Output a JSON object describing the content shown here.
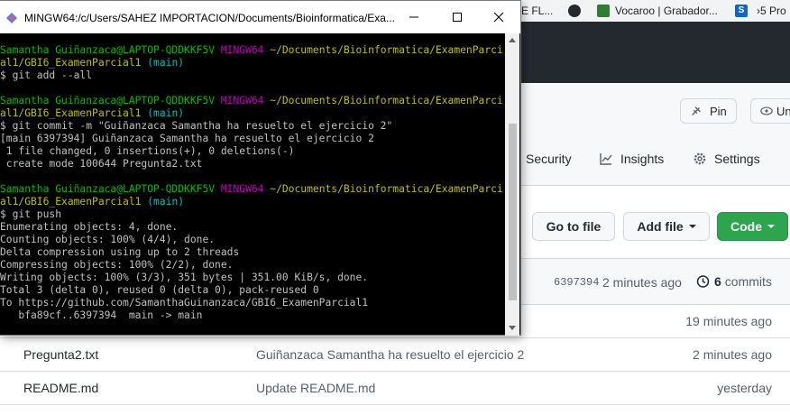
{
  "bookmarks": [
    {
      "label": "E FL...",
      "icon": "bookmark-icon"
    },
    {
      "label": "",
      "icon": "github-icon"
    },
    {
      "label": "Vocaroo | Grabador...",
      "icon": "vocaroo-icon"
    },
    {
      "label": "5 Pro",
      "icon": "s-icon"
    }
  ],
  "repo_header": {
    "pin_label": "Pin",
    "watch_label": "Un"
  },
  "tabs": [
    {
      "label": "Security",
      "icon": "shield-icon"
    },
    {
      "label": "Insights",
      "icon": "graph-icon"
    },
    {
      "label": "Settings",
      "icon": "gear-icon"
    }
  ],
  "actions": {
    "goto_label": "Go to file",
    "addfile_label": "Add file",
    "code_label": "Code"
  },
  "latest_commit": {
    "hash": "6397394",
    "age": "2 minutes ago",
    "commits_count": "6",
    "commits_label": "commits"
  },
  "files": [
    {
      "name": "",
      "message": "",
      "age": "19 minutes ago"
    },
    {
      "name": "Pregunta2.txt",
      "message": "Guiñanzaca Samantha ha resuelto el ejercicio 2",
      "age": "2 minutes ago"
    },
    {
      "name": "README.md",
      "message": "Update README.md",
      "age": "yesterday"
    }
  ],
  "terminal": {
    "title": "MINGW64:/c/Users/SAHEZ IMPORTACION/Documents/Bioinformatica/Exa...",
    "lines": [
      [
        {
          "t": "Samantha Guiñanzaca@LAPTOP-QDDKKF5V ",
          "c": "green"
        },
        {
          "t": "MINGW64 ",
          "c": "mag"
        },
        {
          "t": "~/Documents/Bioinformatica/ExamenParci",
          "c": "yel"
        }
      ],
      [
        {
          "t": "al1/GBI6_ExamenParcial1",
          "c": "yel"
        },
        {
          "t": " (main)",
          "c": "cyan"
        }
      ],
      [
        {
          "t": "$ git add --all",
          "c": ""
        }
      ],
      [
        {
          "t": "",
          "c": ""
        }
      ],
      [
        {
          "t": "Samantha Guiñanzaca@LAPTOP-QDDKKF5V ",
          "c": "green"
        },
        {
          "t": "MINGW64 ",
          "c": "mag"
        },
        {
          "t": "~/Documents/Bioinformatica/ExamenParci",
          "c": "yel"
        }
      ],
      [
        {
          "t": "al1/GBI6_ExamenParcial1",
          "c": "yel"
        },
        {
          "t": " (main)",
          "c": "cyan"
        }
      ],
      [
        {
          "t": "$ git commit -m \"Guiñanzaca Samantha ha resuelto el ejercicio 2\"",
          "c": ""
        }
      ],
      [
        {
          "t": "[main 6397394] Guiñanzaca Samantha ha resuelto el ejercicio 2",
          "c": ""
        }
      ],
      [
        {
          "t": " 1 file changed, 0 insertions(+), 0 deletions(-)",
          "c": ""
        }
      ],
      [
        {
          "t": " create mode 100644 Pregunta2.txt",
          "c": ""
        }
      ],
      [
        {
          "t": "",
          "c": ""
        }
      ],
      [
        {
          "t": "Samantha Guiñanzaca@LAPTOP-QDDKKF5V ",
          "c": "green"
        },
        {
          "t": "MINGW64 ",
          "c": "mag"
        },
        {
          "t": "~/Documents/Bioinformatica/ExamenParci",
          "c": "yel"
        }
      ],
      [
        {
          "t": "al1/GBI6_ExamenParcial1",
          "c": "yel"
        },
        {
          "t": " (main)",
          "c": "cyan"
        }
      ],
      [
        {
          "t": "$ git push",
          "c": ""
        }
      ],
      [
        {
          "t": "Enumerating objects: 4, done.",
          "c": ""
        }
      ],
      [
        {
          "t": "Counting objects: 100% (4/4), done.",
          "c": ""
        }
      ],
      [
        {
          "t": "Delta compression using up to 2 threads",
          "c": ""
        }
      ],
      [
        {
          "t": "Compressing objects: 100% (2/2), done.",
          "c": ""
        }
      ],
      [
        {
          "t": "Writing objects: 100% (3/3), 351 bytes | 351.00 KiB/s, done.",
          "c": ""
        }
      ],
      [
        {
          "t": "Total 3 (delta 0), reused 0 (delta 0), pack-reused 0",
          "c": ""
        }
      ],
      [
        {
          "t": "To https://github.com/SamanthaGuinanzaca/GBI6_ExamenParcial1",
          "c": ""
        }
      ],
      [
        {
          "t": "   bfa89cf..6397394  main -> main",
          "c": ""
        }
      ]
    ]
  }
}
